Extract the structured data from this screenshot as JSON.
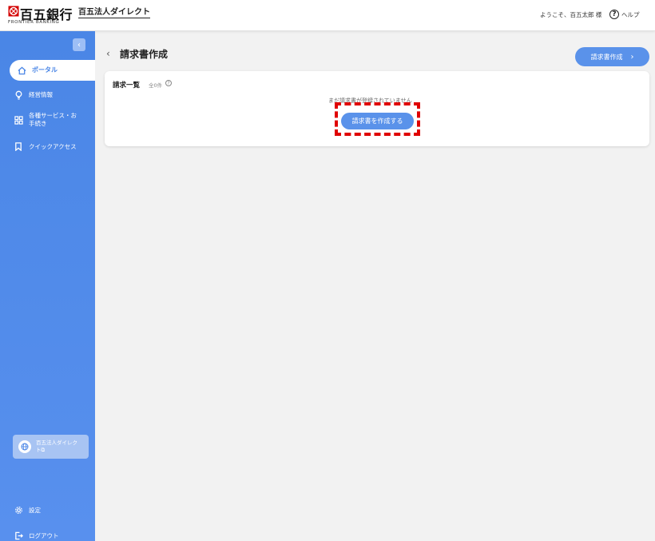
{
  "header": {
    "bank_name": "百五銀行",
    "bank_sub": "FRONTIER BANKING",
    "service_name": "百五法人ダイレクト",
    "welcome": "ようこそ、百五太郎 様",
    "help_icon_glyph": "?",
    "help_label": "ヘルプ",
    "logo_color": "#d40000"
  },
  "sidebar": {
    "collapse_glyph": "‹",
    "items": [
      {
        "label": "ポータル",
        "icon": "home-icon"
      },
      {
        "label": "経営情報",
        "icon": "lightbulb-icon"
      },
      {
        "label": "各種サービス・お手続き",
        "icon": "grid-icon"
      },
      {
        "label": "クイックアクセス",
        "icon": "bookmark-icon"
      }
    ],
    "direct_link_label": "百五法人ダイレクト⧉",
    "settings_label": "設定",
    "logout_label": "ログアウト",
    "accent": "#4a86e6"
  },
  "main": {
    "back_glyph": "‹",
    "title": "請求書作成",
    "top_button_label": "請求書作成",
    "top_button_chevron": "›",
    "card": {
      "title": "請求一覧",
      "count": "全0件",
      "info_glyph": "?",
      "empty_message": "まだ請求書が登録されていません",
      "create_button_label": "請求書を作成する"
    },
    "highlight_color": "#e00000"
  }
}
